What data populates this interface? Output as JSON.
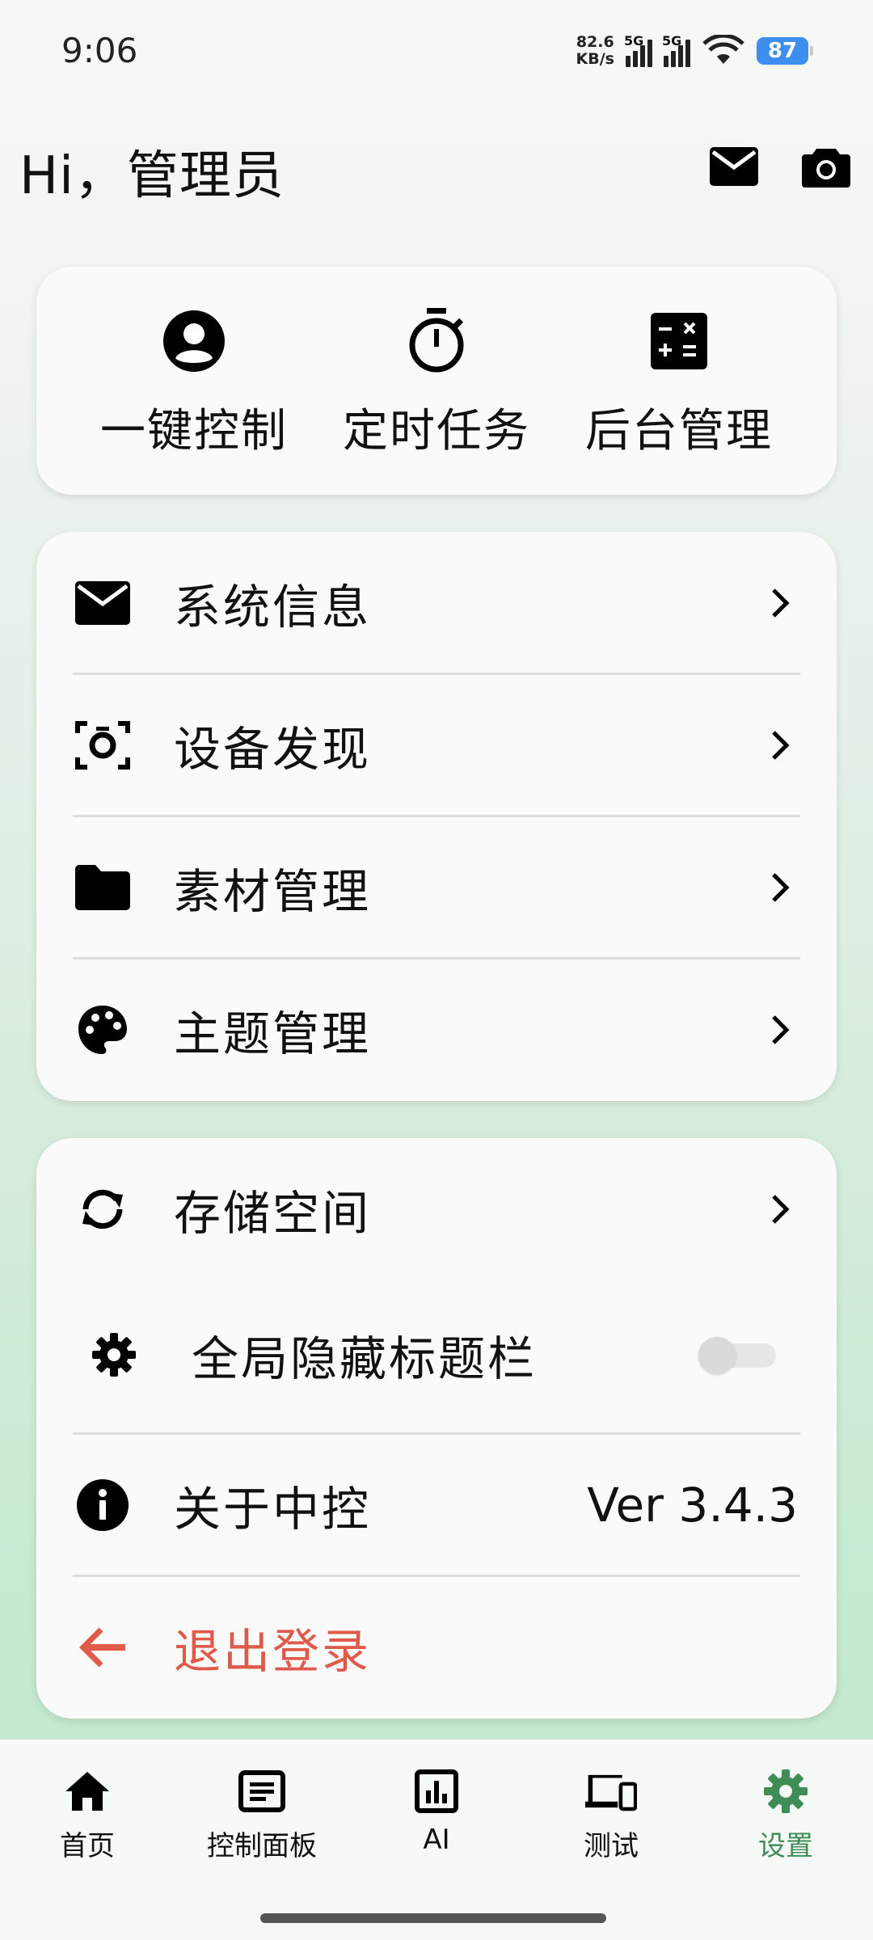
{
  "status_bar": {
    "time": "9:06",
    "net_speed_value": "82.6",
    "net_speed_unit": "KB/s",
    "sim1_label": "5G",
    "sim2_label": "5G",
    "battery": "87"
  },
  "header": {
    "greeting": "Hi，管理员",
    "mail_icon": "mail-icon",
    "camera_icon": "camera-icon"
  },
  "quick_actions": [
    {
      "label": "一键控制",
      "icon": "account-circle-icon"
    },
    {
      "label": "定时任务",
      "icon": "timer-icon"
    },
    {
      "label": "后台管理",
      "icon": "calculator-icon"
    }
  ],
  "menu_primary": [
    {
      "label": "系统信息",
      "icon": "mail-icon"
    },
    {
      "label": "设备发现",
      "icon": "device-scan-icon"
    },
    {
      "label": "素材管理",
      "icon": "folder-icon"
    },
    {
      "label": "主题管理",
      "icon": "palette-icon"
    }
  ],
  "menu_secondary": {
    "storage": {
      "label": "存储空间",
      "icon": "sync-icon"
    },
    "hide_title": {
      "label": "全局隐藏标题栏",
      "icon": "gear-icon",
      "enabled": false
    },
    "about": {
      "label": "关于中控",
      "icon": "info-icon",
      "version": "Ver 3.4.3"
    },
    "logout": {
      "label": "退出登录",
      "icon": "arrow-left-icon",
      "color": "#e05a4a"
    }
  },
  "bottom_nav": {
    "active_color": "#3e8c56",
    "items": [
      {
        "label": "首页",
        "icon": "home-icon"
      },
      {
        "label": "控制面板",
        "icon": "article-icon"
      },
      {
        "label": "AI",
        "icon": "bar-chart-icon"
      },
      {
        "label": "测试",
        "icon": "devices-icon"
      },
      {
        "label": "设置",
        "icon": "gear-icon",
        "active": true
      }
    ]
  }
}
